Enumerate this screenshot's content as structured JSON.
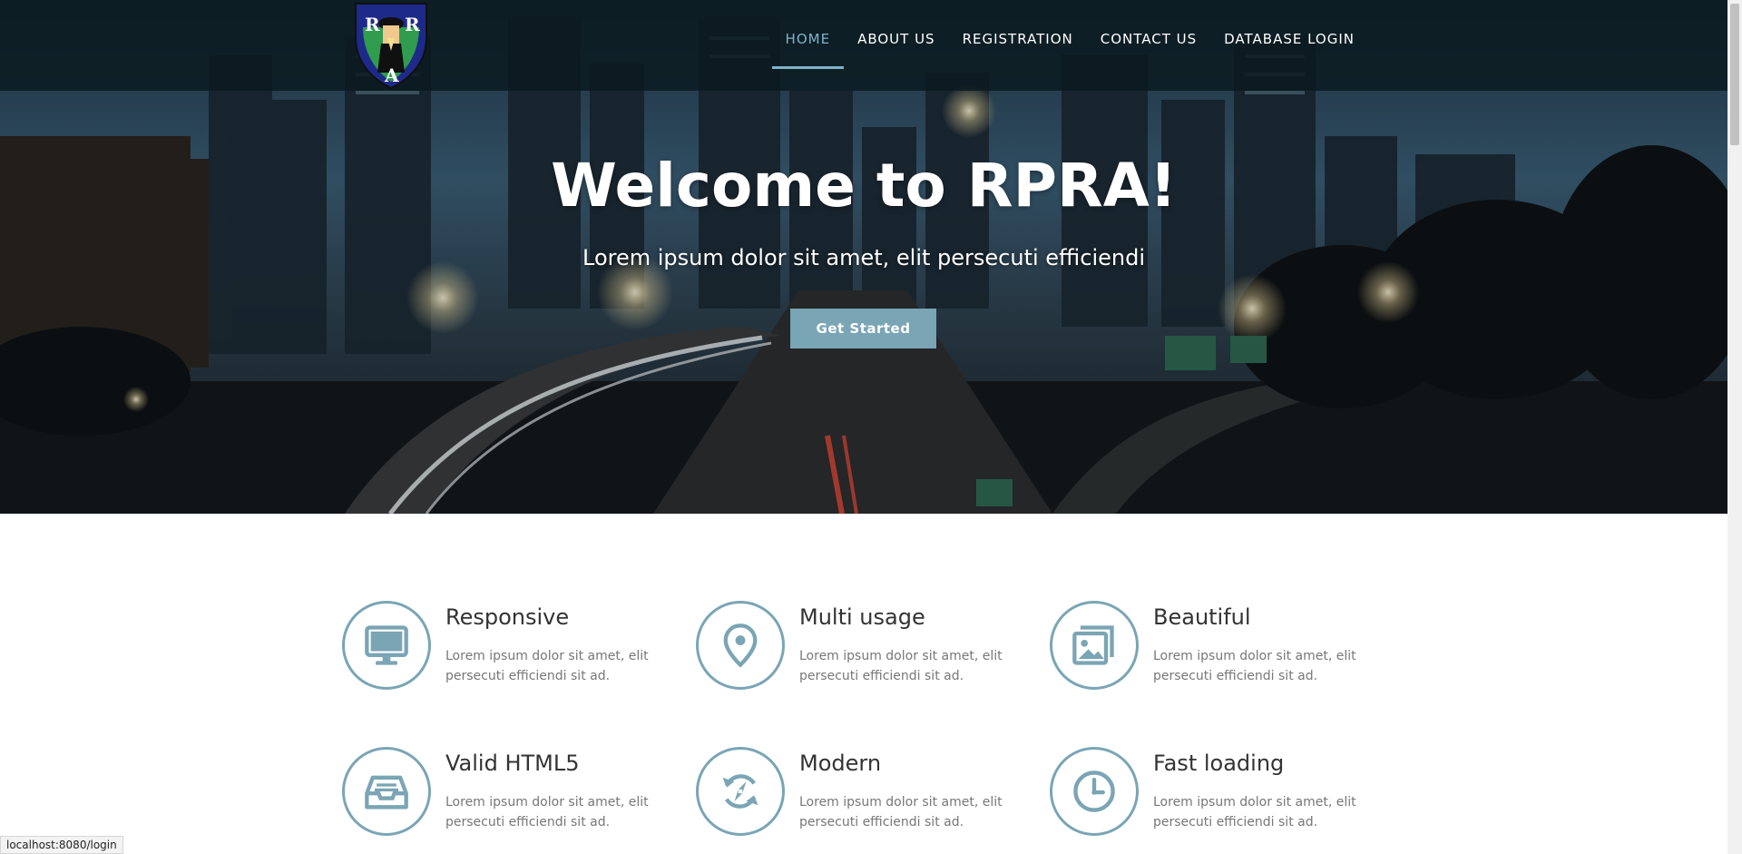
{
  "nav": {
    "items": [
      {
        "label": "HOME",
        "active": true
      },
      {
        "label": "ABOUT US",
        "active": false
      },
      {
        "label": "REGISTRATION",
        "active": false
      },
      {
        "label": "CONTACT US",
        "active": false
      },
      {
        "label": "DATABASE LOGIN",
        "active": false
      }
    ]
  },
  "logo": {
    "letters": [
      "R",
      "R",
      "A"
    ]
  },
  "hero": {
    "title": "Welcome to RPRA!",
    "subtitle": "Lorem ipsum dolor sit amet, elit persecuti efficiendi",
    "button_label": "Get Started"
  },
  "features": [
    {
      "title": "Responsive",
      "desc": "Lorem ipsum dolor sit amet, elit persecuti efficiendi sit ad.",
      "icon": "monitor-icon"
    },
    {
      "title": "Multi usage",
      "desc": "Lorem ipsum dolor sit amet, elit persecuti efficiendi sit ad.",
      "icon": "map-pin-icon"
    },
    {
      "title": "Beautiful",
      "desc": "Lorem ipsum dolor sit amet, elit persecuti efficiendi sit ad.",
      "icon": "images-icon"
    },
    {
      "title": "Valid HTML5",
      "desc": "Lorem ipsum dolor sit amet, elit persecuti efficiendi sit ad.",
      "icon": "inbox-tray-icon"
    },
    {
      "title": "Modern",
      "desc": "Lorem ipsum dolor sit amet, elit persecuti efficiendi sit ad.",
      "icon": "refresh-arrows-icon"
    },
    {
      "title": "Fast loading",
      "desc": "Lorem ipsum dolor sit amet, elit persecuti efficiendi sit ad.",
      "icon": "clock-icon"
    }
  ],
  "status_bar": {
    "url": "localhost:8080/login"
  },
  "colors": {
    "accent": "#7aa5b5",
    "nav_bg": "#0a1a1e",
    "active_nav": "#7fb3c8"
  }
}
